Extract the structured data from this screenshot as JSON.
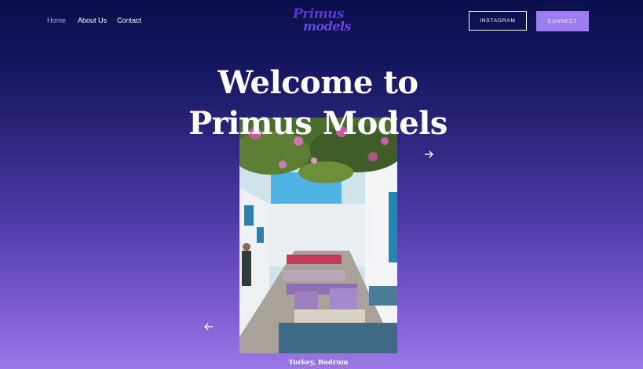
{
  "nav": {
    "links": [
      {
        "label": "Home",
        "active": true
      },
      {
        "label": "About Us",
        "active": false
      },
      {
        "label": "Contact",
        "active": false
      }
    ]
  },
  "logo": {
    "line1": "Primus",
    "line2": "models"
  },
  "header_buttons": {
    "instagram": "INSTAGRAM",
    "connect": "CONNECT"
  },
  "hero": {
    "title_line1": "Welcome to",
    "title_line2": "Primus Models"
  },
  "slide": {
    "caption": "Turkey, Bodrum",
    "prev_icon": "arrow-left-icon",
    "next_icon": "arrow-right-icon"
  },
  "colors": {
    "accent": "#9d7df3",
    "active_link": "#b79cff",
    "logo": "#5b35d8",
    "bg_top": "#0b0f4d",
    "bg_bottom": "#9a78e6"
  }
}
